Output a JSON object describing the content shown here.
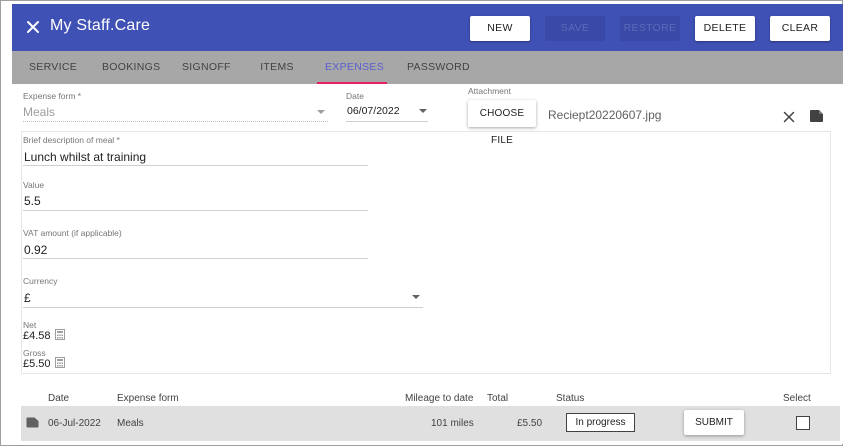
{
  "header": {
    "title": "My Staff.Care",
    "buttons": {
      "new": "NEW",
      "save": "SAVE",
      "restore": "RESTORE",
      "delete": "DELETE",
      "clear": "CLEAR"
    }
  },
  "tabs": [
    "SERVICE",
    "BOOKINGS",
    "SIGNOFF",
    "ITEMS",
    "EXPENSES",
    "PASSWORD"
  ],
  "active_tab": "EXPENSES",
  "form": {
    "expense_form": {
      "label": "Expense form *",
      "value": "Meals"
    },
    "date": {
      "label": "Date",
      "value": "06/07/2022"
    },
    "attachment": {
      "label": "Attachment",
      "button": "CHOOSE FILE",
      "filename": "Reciept20220607.jpg"
    },
    "description": {
      "label": "Brief description of meal *",
      "value": "Lunch whilst at training"
    },
    "value": {
      "label": "Value",
      "value": "5.5"
    },
    "vat": {
      "label": "VAT amount (if applicable)",
      "value": "0.92"
    },
    "currency": {
      "label": "Currency",
      "value": "£"
    },
    "net": {
      "label": "Net",
      "value": "£4.58"
    },
    "gross": {
      "label": "Gross",
      "value": "£5.50"
    }
  },
  "table": {
    "headers": {
      "date": "Date",
      "expense_form": "Expense form",
      "mileage": "Mileage to date",
      "total": "Total",
      "status": "Status",
      "select": "Select"
    },
    "rows": [
      {
        "date": "06-Jul-2022",
        "expense_form": "Meals",
        "mileage": "101 miles",
        "total": "£5.50",
        "status": "In progress",
        "action": "SUBMIT"
      }
    ]
  },
  "colors": {
    "appbar": "#3f51b5",
    "tabbar": "#a7a7a7",
    "tab_active_text": "#5a5fd0",
    "tab_indicator": "#e91e63",
    "row_bg": "#e0e0e0"
  },
  "icons": [
    "close-icon",
    "file-icon",
    "calculator-icon",
    "dropdown-arrow-icon",
    "document-icon"
  ]
}
